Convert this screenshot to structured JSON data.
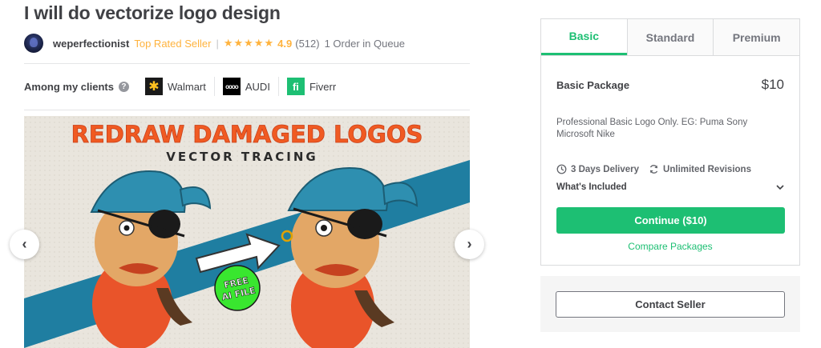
{
  "gig": {
    "title": "I will do vectorize logo design"
  },
  "seller": {
    "name": "weperfectionist",
    "level": "Top Rated Seller",
    "separator": "|",
    "stars": "★★★★★",
    "rating": "4.9",
    "reviews": "(512)",
    "queue": "1 Order in Queue"
  },
  "clients": {
    "label": "Among my clients",
    "help_icon": "?",
    "items": [
      {
        "name": "Walmart",
        "icon": "walmart-spark-icon",
        "glyph": "✱"
      },
      {
        "name": "AUDI",
        "icon": "audi-rings-icon",
        "glyph": "oooo"
      },
      {
        "name": "Fiverr",
        "icon": "fiverr-logo-icon",
        "glyph": "fi"
      }
    ]
  },
  "gallery": {
    "headline": "REDRAW DAMAGED LOGOS",
    "subheadline": "VECTOR TRACING",
    "badge_line1": "FREE",
    "badge_line2": "AI FILE",
    "prev_icon": "‹",
    "next_icon": "›"
  },
  "package": {
    "tabs": [
      {
        "label": "Basic",
        "active": true
      },
      {
        "label": "Standard",
        "active": false
      },
      {
        "label": "Premium",
        "active": false
      }
    ],
    "name": "Basic Package",
    "price": "$10",
    "description": "Professional Basic Logo Only. EG: Puma Sony Microsoft Nike",
    "delivery": "3 Days Delivery",
    "revisions": "Unlimited Revisions",
    "included_label": "What's Included",
    "continue_label": "Continue ($10)",
    "compare_label": "Compare Packages"
  },
  "contact": {
    "label": "Contact Seller"
  },
  "colors": {
    "brand_green": "#1dbf73",
    "star_yellow": "#ffb33e",
    "text_dark": "#404145",
    "headline_orange": "#f05a22",
    "stripe_blue": "#1f7ea1"
  }
}
